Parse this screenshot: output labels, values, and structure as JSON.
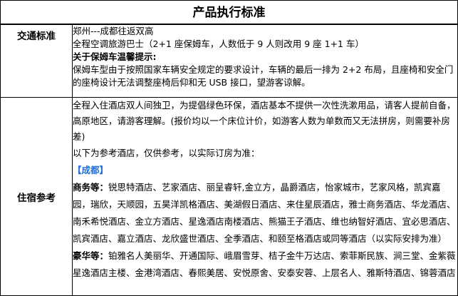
{
  "title": "产品执行标准",
  "traffic": {
    "label": "交通标准",
    "lines": [
      "郑州---成都往返双高",
      "全程空调旅游巴士（2+1 座保姆车，人数低于 9 人则改用 9 座 1+1 车）"
    ],
    "tips_heading": "关于保姆车温馨提示:",
    "tips_lines": [
      "保姆车型由于按照国家车辆安全规定的要求设计，车辆的最后一排为 2+2 布局，且座椅和安全门",
      "的座椅设计无法调整座椅后仰和无 USB 接口，望游客谅解。"
    ]
  },
  "hotel": {
    "label": "住宿参考",
    "paragraph": "全程入住酒店双人间独卫，为提倡绿色环保，酒店基本不提供一次性洗漱用品，请客人提前自备，高原地区，请游客理解。(报价均以一个床位计价，如游客人数为单数而又无法拼房，则需要补房差)",
    "reference_note": "以下为参考酒店，仅供参考，以实际订房为准：",
    "city": "【成都】",
    "standard_label": "商务等：",
    "standard_text": "锐思特酒店、艺家酒店、丽呈睿轩,金立方，晶爵酒店，怡家城市，艺家风格，凯宾嘉园，瑞欣，天顺园，五昊洋凯格酒店、美湖假日酒店、来住星辰酒店，雅士商务酒店、华龙酒店、南禾希悦酒店、金立方酒店、星逸酒店南楼酒店、熊猫王子酒店、维也纳智好酒店、宜必思酒店、凯宾酒店、嘉立酒店、龙欣盛世酒店、全季酒店、和颐至格酒店或同等酒店（以实际安排为准）",
    "luxury_label": "豪华等：",
    "luxury_text": "铂雅名人美丽华、开通国际、峨眉雪芽、桔子金牛万达店、索菲斯民族、涧三堂、金紫薇星逸酒店主楼、金港湾酒店、春熙美居、安悦原舍、安泰安蓉、上层名人、雅斯特酒店、锦蓉酒店"
  }
}
